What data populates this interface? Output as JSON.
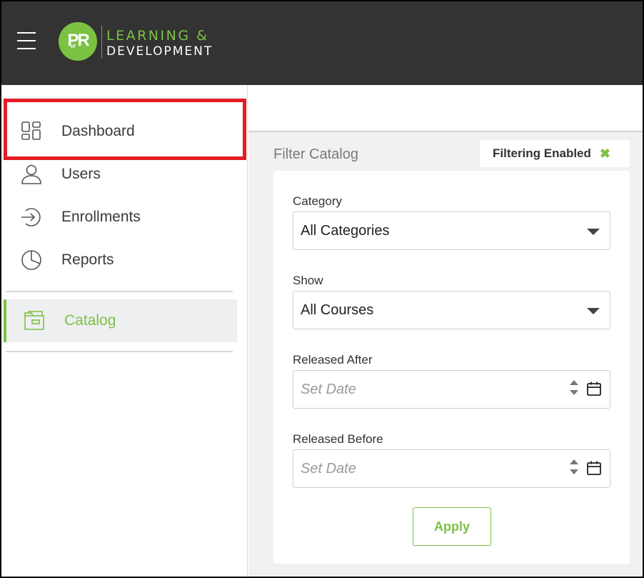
{
  "header": {
    "logo_monogram": "PR",
    "logo_of": "of",
    "logo_line1": "LEARNING &",
    "logo_line2": "DEVELOPMENT",
    "menu_icon": "hamburger-icon"
  },
  "sidebar": {
    "items": [
      {
        "label": "Dashboard",
        "icon": "dashboard-icon"
      },
      {
        "label": "Users",
        "icon": "user-icon"
      },
      {
        "label": "Enrollments",
        "icon": "enroll-icon"
      },
      {
        "label": "Reports",
        "icon": "pie-chart-icon"
      }
    ],
    "active_item": {
      "label": "Catalog",
      "icon": "folder-icon"
    }
  },
  "filter": {
    "title": "Filter Catalog",
    "badge_label": "Filtering Enabled",
    "badge_close": "✖",
    "category_label": "Category",
    "category_value": "All Categories",
    "show_label": "Show",
    "show_value": "All Courses",
    "released_after_label": "Released After",
    "released_after_placeholder": "Set Date",
    "released_before_label": "Released Before",
    "released_before_placeholder": "Set Date",
    "apply_label": "Apply"
  },
  "colors": {
    "accent": "#7cc242",
    "header_bg": "#333333",
    "highlight": "#e41c23"
  }
}
